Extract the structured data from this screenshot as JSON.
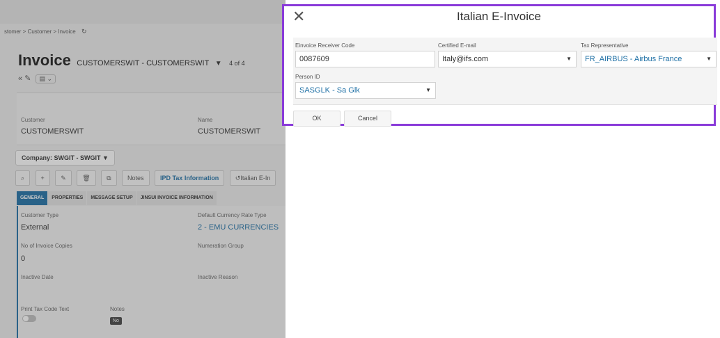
{
  "background": {
    "breadcrumb": [
      "stomer",
      "Customer",
      "Invoice"
    ],
    "title": "Invoice",
    "subtitle": "CUSTOMERSWIT - CUSTOMERSWIT",
    "record_count": "4 of 4",
    "header_fields": {
      "customer_label": "Customer",
      "customer_value": "CUSTOMERSWIT",
      "name_label": "Name",
      "name_value": "CUSTOMERSWIT"
    },
    "company": "Company: SWGIT - SWGIT",
    "toolbar": {
      "notes": "Notes",
      "ipd_tax": "IPD Tax Information",
      "italian": "Italian E-In"
    },
    "tabs": [
      "GENERAL",
      "PROPERTIES",
      "MESSAGE SETUP",
      "JINSUI INVOICE INFORMATION"
    ],
    "general": {
      "customer_type_label": "Customer Type",
      "customer_type_value": "External",
      "currency_rate_label": "Default Currency Rate Type",
      "currency_rate_value": "2 - EMU CURRENCIES",
      "copies_label": "No of Invoice Copies",
      "copies_value": "0",
      "numeration_label": "Numeration Group",
      "inactive_date_label": "Inactive Date",
      "inactive_reason_label": "Inactive Reason",
      "print_tax_label": "Print Tax Code Text",
      "notes_label": "Notes",
      "notes_value": "No"
    }
  },
  "dialog": {
    "title": "Italian E-Invoice",
    "fields": {
      "receiver_code_label": "Einvoice Receiver Code",
      "receiver_code_value": "0087609",
      "email_label": "Certified E-mail",
      "email_value": "Italy@ifs.com",
      "tax_rep_label": "Tax Representative",
      "tax_rep_value": "FR_AIRBUS - Airbus France",
      "person_label": "Person ID",
      "person_value": "SASGLK - Sa Glk"
    },
    "ok_label": "OK",
    "cancel_label": "Cancel"
  },
  "colors": {
    "accent": "#1d6fa5",
    "dialog_border": "#8a3bd9"
  }
}
